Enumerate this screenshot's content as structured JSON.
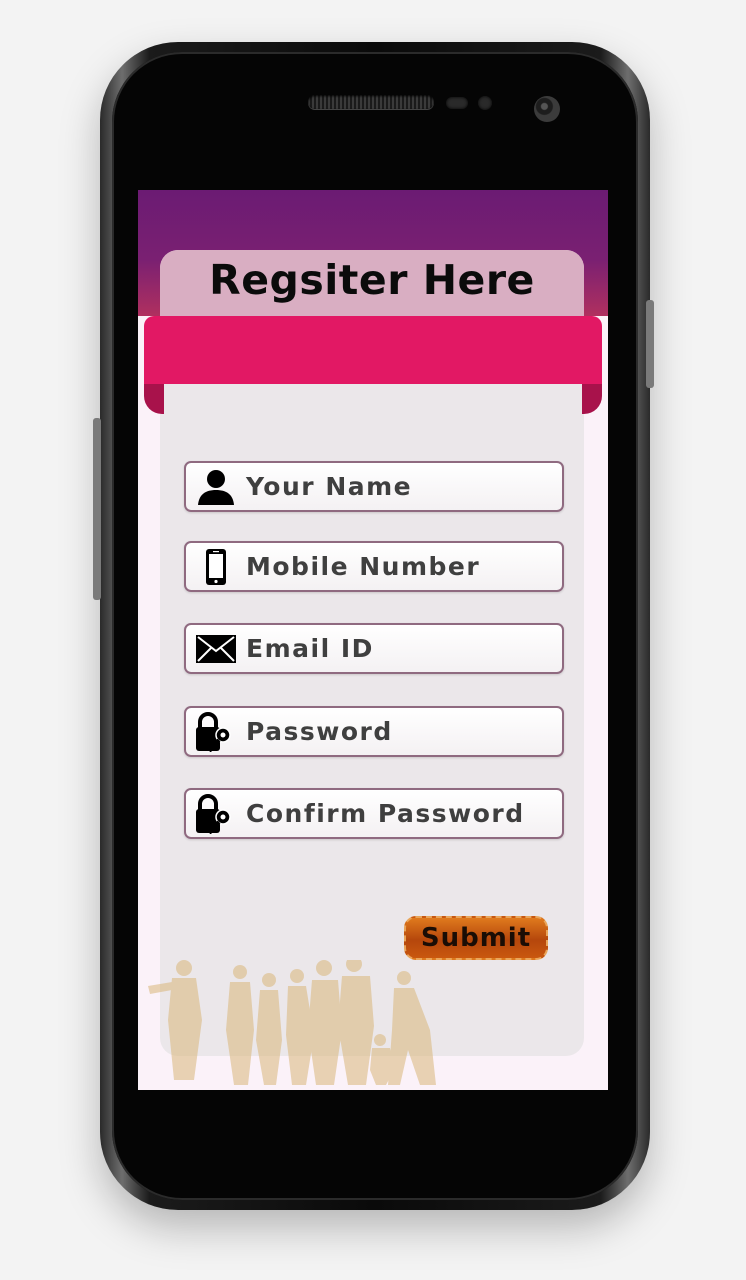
{
  "form": {
    "title": "Regsiter Here",
    "fields": [
      {
        "label": "Your Name",
        "icon": "person-icon"
      },
      {
        "label": "Mobile Number",
        "icon": "mobile-icon"
      },
      {
        "label": "Email ID",
        "icon": "envelope-icon"
      },
      {
        "label": "Password",
        "icon": "lock-key-icon"
      },
      {
        "label": "Confirm Password",
        "icon": "lock-key-icon"
      }
    ],
    "submit_label": "Submit"
  },
  "colors": {
    "header_purple": "#6b1b73",
    "ribbon_pink": "#e21864",
    "card_bg": "#ebe7ea",
    "submit_orange": "#c9570f"
  }
}
